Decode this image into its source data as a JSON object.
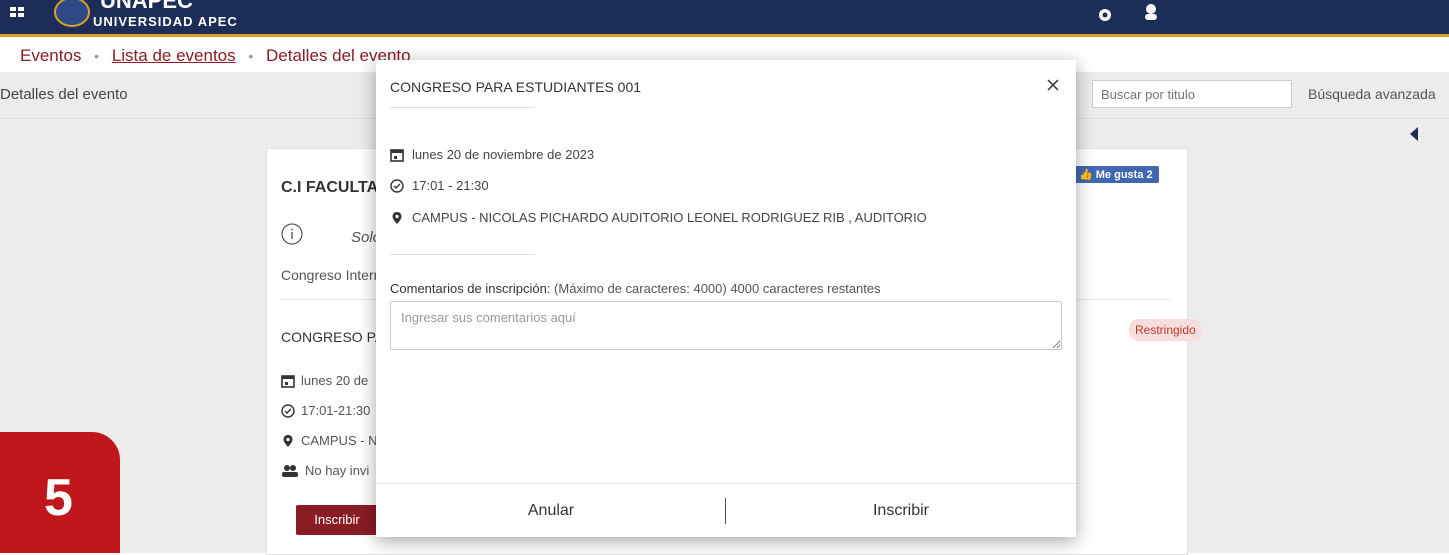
{
  "topbar": {
    "brand_sub": "UNIVERSIDAD APEC",
    "brand_main": "UNAPEC"
  },
  "breadcrumb": {
    "items": [
      "Eventos",
      "Lista de eventos",
      "Detalles del evento"
    ],
    "separator": "•"
  },
  "subheader": {
    "title": "Detalles del evento",
    "search_placeholder": "Buscar por titulo",
    "advanced_search": "Búsqueda avanzada"
  },
  "card": {
    "facultad": "C.I FACULTA",
    "solo": "Solo",
    "intern": "Congreso Intern",
    "congreso": "CONGRESO PAR",
    "date": "lunes 20 de",
    "time": "17:01-21:30",
    "location": "CAMPUS - N",
    "invites": "No hay invi",
    "inscribir": "Inscribir",
    "restringido": "Restringido",
    "megusta": "Me gusta 2"
  },
  "overlay_number": "5",
  "modal": {
    "title": "CONGRESO PARA ESTUDIANTES 001",
    "date": "lunes 20 de noviembre de 2023",
    "time": "17:01  -  21:30",
    "location": "CAMPUS - NICOLAS PICHARDO AUDITORIO LEONEL RODRIGUEZ RIB , AUDITORIO",
    "comments_label": "Comentarios de inscripción:",
    "comments_hint": "(Máximo de caracteres: 4000) 4000 caracteres restantes",
    "comments_placeholder": "Ingresar sus comentarios aquí",
    "cancel_label": "Anular",
    "submit_label": "Inscribir"
  },
  "colors": {
    "topbar": "#1c2d57",
    "topbar_accent": "#d9a12a",
    "brand_red": "#8a1c24",
    "overlay_red": "#c1161c"
  }
}
